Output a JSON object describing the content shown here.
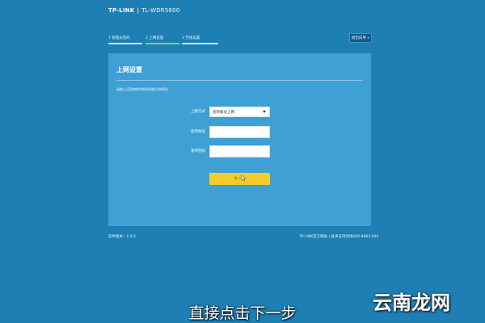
{
  "header": {
    "brand": "TP-LINK",
    "model": "TL-WDR5600"
  },
  "steps": [
    {
      "label": "1 管理员密码"
    },
    {
      "label": "2 上网设置"
    },
    {
      "label": "3 无线设置"
    }
  ],
  "exit_button": {
    "label": "退出向导 »"
  },
  "panel": {
    "title": "上网设置",
    "description": "请输入运营商提供的宽带帐号和密码"
  },
  "form": {
    "mode_label": "上网方式",
    "mode_value": "宽带拨号上网",
    "account_label": "宽带帐号",
    "account_value": "",
    "password_label": "宽带密码",
    "password_value": "",
    "next_label": "下一步"
  },
  "footer": {
    "version": "软件版本：1.0.5",
    "links": "TP-LINK官方网站 | 技术支持热线400-8863-400"
  },
  "overlay": {
    "caption": "直接点击下一步",
    "watermark": "云南龙网"
  },
  "colors": {
    "background": "#1e7fb4",
    "panel": "#3fa0d6",
    "accent_button": "#f4cc2e",
    "active_step": "#8bd34a"
  }
}
